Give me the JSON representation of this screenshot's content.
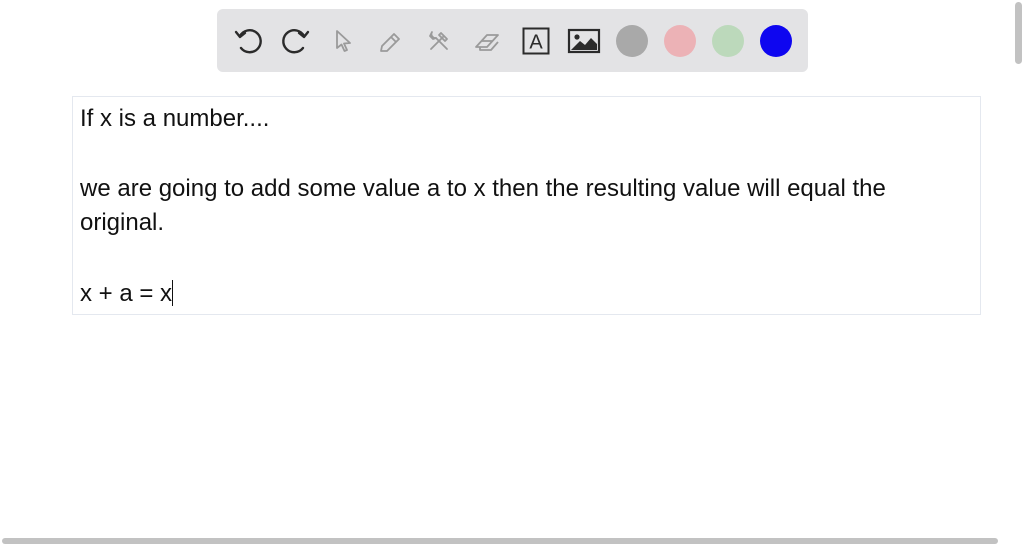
{
  "toolbar": {
    "tools": [
      {
        "icon": "undo-icon"
      },
      {
        "icon": "redo-icon"
      },
      {
        "icon": "select-pointer-icon"
      },
      {
        "icon": "pen-icon"
      },
      {
        "icon": "tools-icon"
      },
      {
        "icon": "eraser-icon"
      },
      {
        "icon": "text-tool-icon",
        "glyph": "A"
      },
      {
        "icon": "image-icon"
      }
    ],
    "colors": [
      "#a9a9a9",
      "#ecb2b6",
      "#bcd9bb",
      "#0e06f0"
    ]
  },
  "document": {
    "line1": "If x is a number....",
    "line2": "we are going to add some value a to x then the resulting value will equal the",
    "line3": "original.",
    "line4": "x + a = x"
  }
}
